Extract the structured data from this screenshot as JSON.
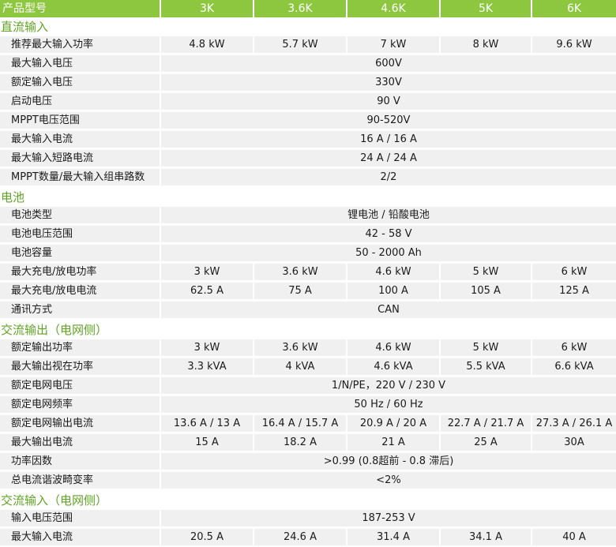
{
  "header": {
    "label": "产品型号",
    "models": [
      "3K",
      "3.6K",
      "4.6K",
      "5K",
      "6K"
    ]
  },
  "sections": [
    {
      "title": "直流输入",
      "rows": [
        {
          "label": "推荐最大输入功率",
          "values": [
            "4.8 kW",
            "5.7 kW",
            "7 kW",
            "8 kW",
            "9.6 kW"
          ]
        },
        {
          "label": "最大输入电压",
          "values": [
            "600V"
          ]
        },
        {
          "label": "额定输入电压",
          "values": [
            "330V"
          ]
        },
        {
          "label": "启动电压",
          "values": [
            "90 V"
          ]
        },
        {
          "label": "MPPT电压范围",
          "values": [
            "90-520V"
          ]
        },
        {
          "label": "最大输入电流",
          "values": [
            "16 A / 16 A"
          ]
        },
        {
          "label": "最大输入短路电流",
          "values": [
            "24 A / 24 A"
          ]
        },
        {
          "label": "MPPT数量/最大输入组串路数",
          "values": [
            "2/2"
          ]
        }
      ]
    },
    {
      "title": "电池",
      "rows": [
        {
          "label": "电池类型",
          "values": [
            "锂电池 / 铅酸电池"
          ]
        },
        {
          "label": "电池电压范围",
          "values": [
            "42 - 58 V"
          ]
        },
        {
          "label": "电池容量",
          "values": [
            "50 - 2000 Ah"
          ]
        },
        {
          "label": "最大充电/放电功率",
          "values": [
            "3 kW",
            "3.6 kW",
            "4.6 kW",
            "5 kW",
            "6 kW"
          ]
        },
        {
          "label": "最大充电/放电电流",
          "values": [
            "62.5 A",
            "75 A",
            "100 A",
            "105 A",
            "125 A"
          ]
        },
        {
          "label": "通讯方式",
          "values": [
            "CAN"
          ]
        }
      ]
    },
    {
      "title": "交流输出（电网侧）",
      "rows": [
        {
          "label": "额定输出功率",
          "values": [
            "3 kW",
            "3.6 kW",
            "4.6 kW",
            "5 kW",
            "6 kW"
          ]
        },
        {
          "label": "最大输出视在功率",
          "values": [
            "3.3 kVA",
            "4 kVA",
            "4.6 kVA",
            "5.5 kVA",
            "6.6 kVA"
          ]
        },
        {
          "label": "额定电网电压",
          "values": [
            "1/N/PE，220 V / 230 V"
          ]
        },
        {
          "label": "额定电网频率",
          "values": [
            "50 Hz / 60 Hz"
          ]
        },
        {
          "label": "额定电网输出电流",
          "values": [
            "13.6 A / 13 A",
            "16.4 A / 15.7 A",
            "20.9 A / 20 A",
            "22.7 A / 21.7 A",
            "27.3 A / 26.1 A"
          ]
        },
        {
          "label": "最大输出电流",
          "values": [
            "15 A",
            "18.2 A",
            "21 A",
            "25 A",
            "30A"
          ]
        },
        {
          "label": "功率因数",
          "values": [
            ">0.99 (0.8超前 - 0.8 滞后)"
          ]
        },
        {
          "label": "总电流谐波畸变率",
          "values": [
            "<2%"
          ]
        }
      ]
    },
    {
      "title": "交流输入（电网侧）",
      "rows": [
        {
          "label": "输入电压范围",
          "values": [
            "187-253 V"
          ]
        },
        {
          "label": "最大输入电流",
          "values": [
            "20.5 A",
            "24.6 A",
            "31.4 A",
            "34.1 A",
            "40 A"
          ]
        }
      ]
    }
  ]
}
